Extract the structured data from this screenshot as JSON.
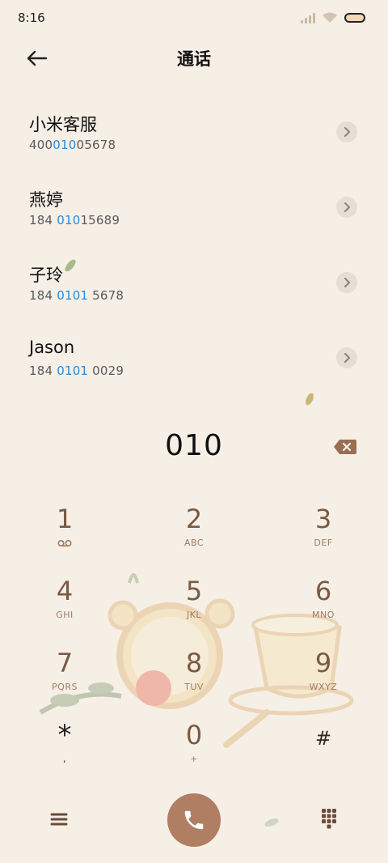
{
  "status": {
    "time": "8:16"
  },
  "header": {
    "title": "通话"
  },
  "results": [
    {
      "name": "小米客服",
      "number_pre": "400",
      "number_hl": "010",
      "number_post": "05678"
    },
    {
      "name": "燕婷",
      "number_pre": "184 ",
      "number_hl": "010",
      "number_post": "15689"
    },
    {
      "name": "子玲",
      "number_pre": "184 ",
      "number_hl": "0101",
      "number_post": " 5678"
    },
    {
      "name": "Jason",
      "number_pre": "184 ",
      "number_hl": "0101",
      "number_post": " 0029"
    }
  ],
  "dialer": {
    "digits": "010"
  },
  "keypad": [
    {
      "num": "1",
      "letters": ""
    },
    {
      "num": "2",
      "letters": "ABC"
    },
    {
      "num": "3",
      "letters": "DEF"
    },
    {
      "num": "4",
      "letters": "GHI"
    },
    {
      "num": "5",
      "letters": "JKL"
    },
    {
      "num": "6",
      "letters": "MNO"
    },
    {
      "num": "7",
      "letters": "PQRS"
    },
    {
      "num": "8",
      "letters": "TUV"
    },
    {
      "num": "9",
      "letters": "WXYZ"
    },
    {
      "num": "*",
      "letters": ","
    },
    {
      "num": "0",
      "letters": "+"
    },
    {
      "num": "#",
      "letters": ""
    }
  ],
  "icons": {
    "back": "arrow-left-icon",
    "chevron": "chevron-right-icon",
    "backspace": "backspace-icon",
    "voicemail": "voicemail-icon",
    "menu": "menu-icon",
    "call": "phone-icon",
    "keypad": "dialpad-icon"
  },
  "colors": {
    "accent": "#2a8ad6",
    "key": "#7a5a43",
    "call": "#b07f63",
    "background": "#f6efe6"
  }
}
